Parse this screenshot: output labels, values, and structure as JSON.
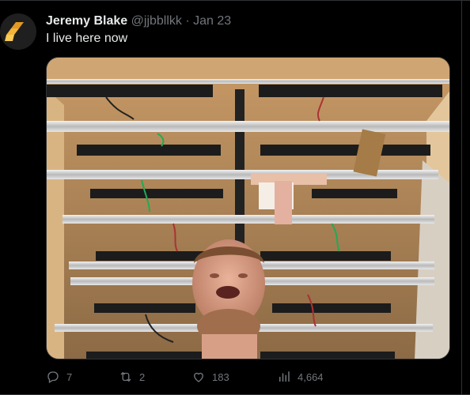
{
  "tweet": {
    "author_name": "Jeremy Blake",
    "handle": "@jjbbllkk",
    "separator": "·",
    "date": "Jan 23",
    "text": "I live here now",
    "media_alt": "Photo of a man lying beneath a wooden rack of modular synthesizer rails"
  },
  "actions": {
    "replies": "7",
    "reposts": "2",
    "likes": "183",
    "views": "4,664"
  },
  "colors": {
    "background": "#000000",
    "text_primary": "#e7e9ea",
    "text_muted": "#71767b",
    "divider": "#2f3336",
    "avatar_logo": "#f2b53a"
  },
  "icons": [
    "logo-icon",
    "reply-icon",
    "repost-icon",
    "like-icon",
    "views-icon"
  ]
}
